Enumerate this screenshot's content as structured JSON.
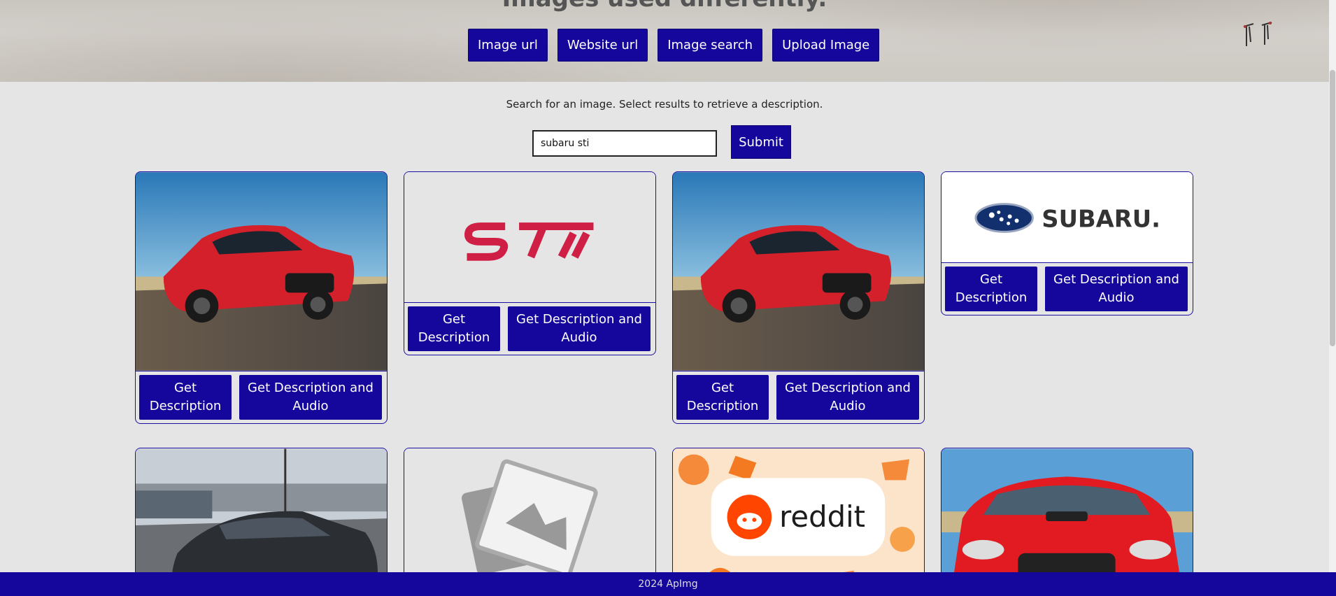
{
  "hero": {
    "title": "Images used differently.",
    "buttons": [
      "Image url",
      "Website url",
      "Image search",
      "Upload Image"
    ]
  },
  "search": {
    "instructions": "Search for an image. Select results to retrieve a description.",
    "query": "subaru sti",
    "submit_label": "Submit"
  },
  "cards": [
    {
      "image": "red-subaru-wrx-car",
      "desc_label": "Get Description",
      "audio_label": "Get Description and Audio"
    },
    {
      "image": "sti-logo",
      "logo_text": "STI",
      "desc_label": "Get Description",
      "audio_label": "Get Description and Audio"
    },
    {
      "image": "red-subaru-wrx-car",
      "desc_label": "Get Description",
      "audio_label": "Get Description and Audio"
    },
    {
      "image": "subaru-logo",
      "logo_text": "SUBARU.",
      "desc_label": "Get Description",
      "audio_label": "Get Description and Audio"
    },
    {
      "image": "gray-subaru-sti-parking-lot"
    },
    {
      "image": "image-placeholder"
    },
    {
      "image": "reddit-banner",
      "logo_text": "reddit"
    },
    {
      "image": "red-subaru-sti-front"
    }
  ],
  "footer": {
    "text": "2024 ApImg"
  },
  "colors": {
    "accent": "#15079b",
    "background": "#e5e5e5"
  }
}
